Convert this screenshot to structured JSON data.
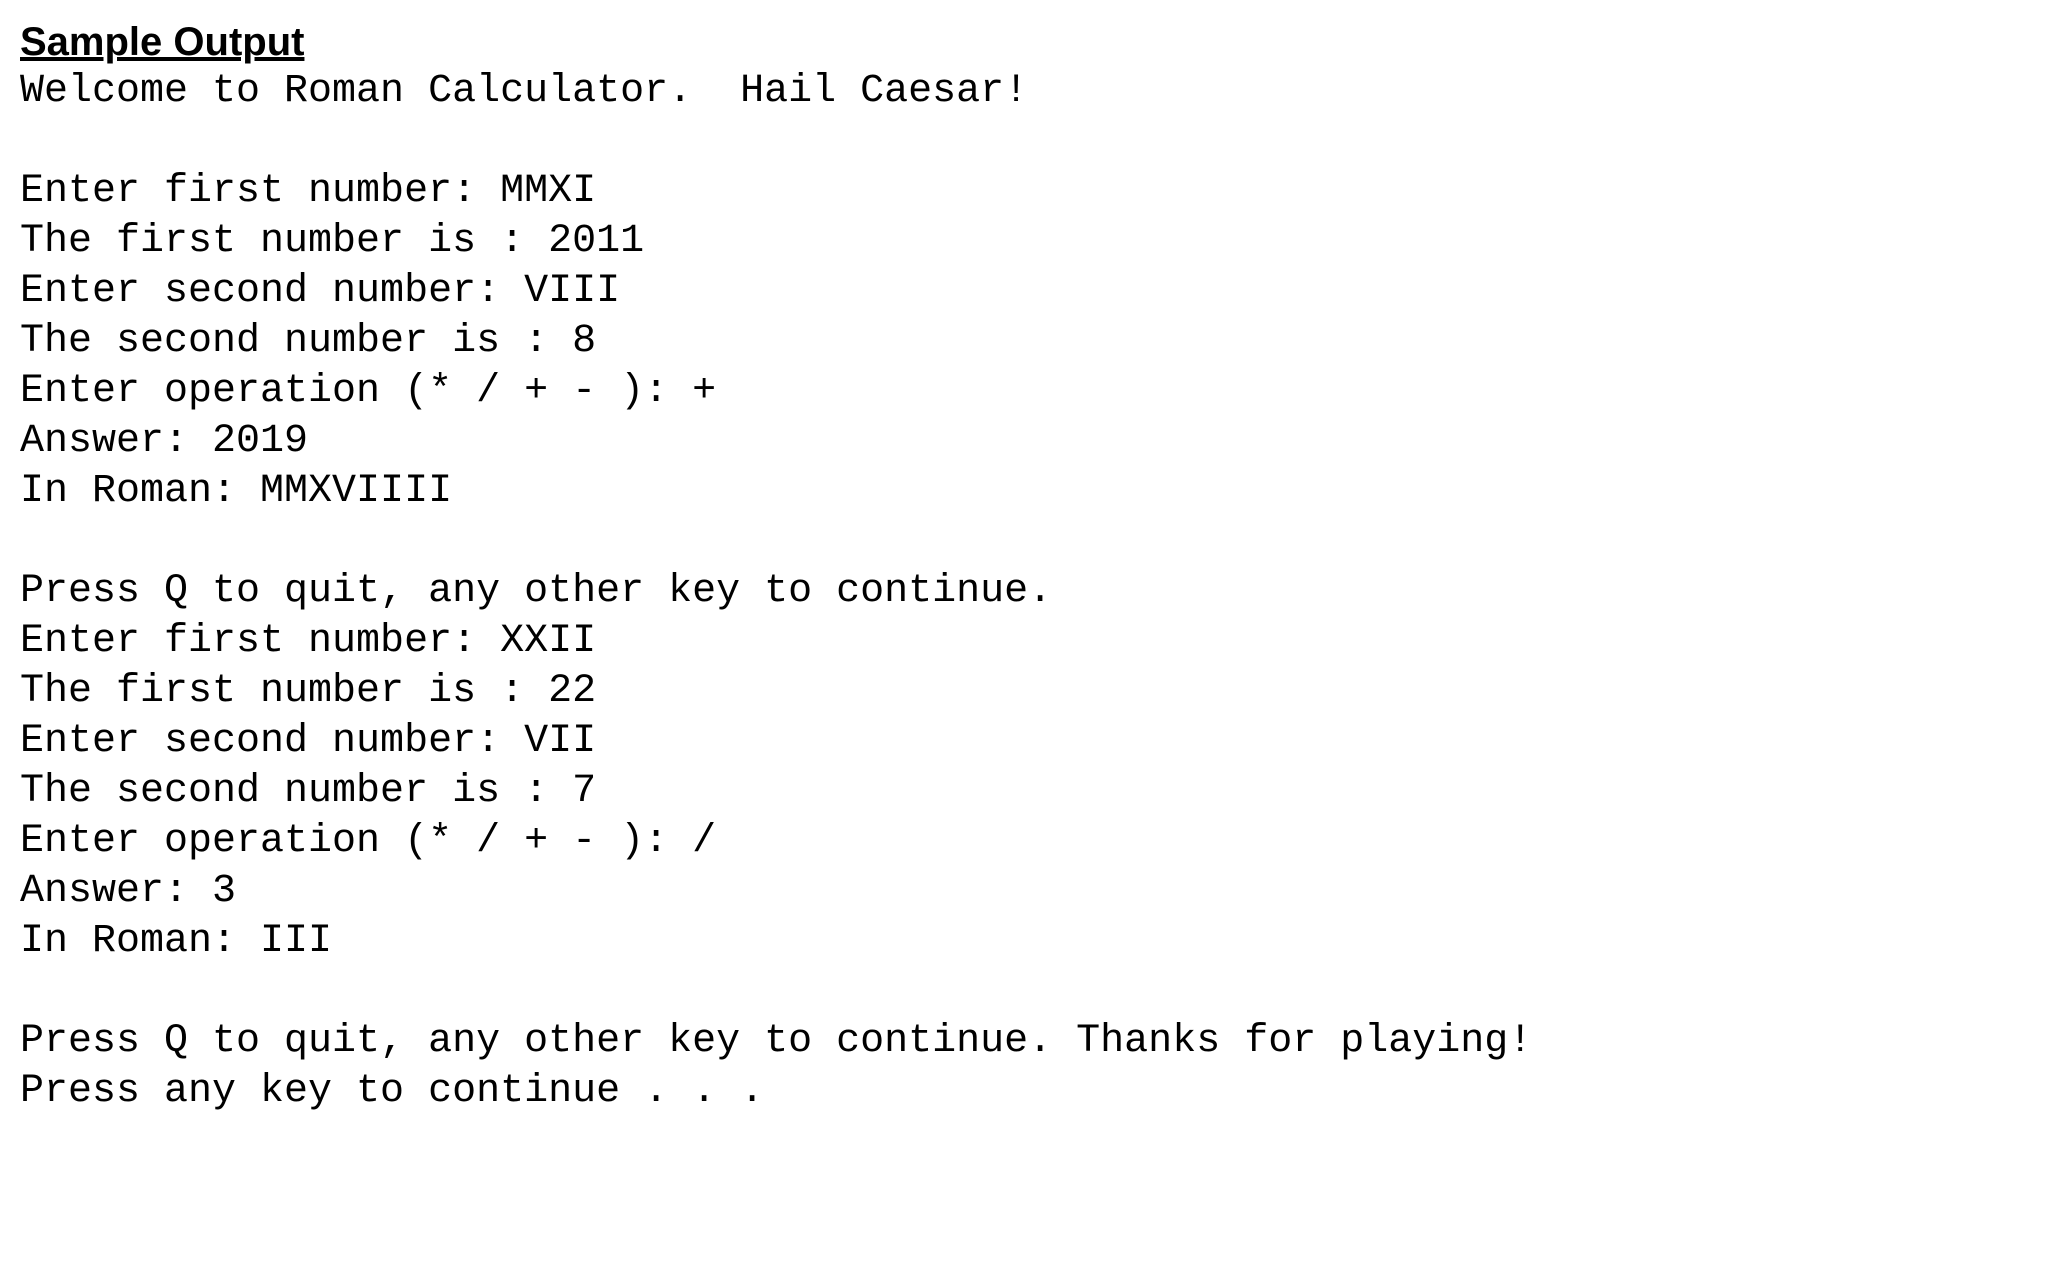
{
  "heading": "Sample Output",
  "lines": {
    "l0": "Welcome to Roman Calculator.  Hail Caesar!",
    "l1": "",
    "l2": "Enter first number: MMXI",
    "l3": "The first number is : 2011",
    "l4": "Enter second number: VIII",
    "l5": "The second number is : 8",
    "l6": "Enter operation (* / + - ): +",
    "l7": "Answer: 2019",
    "l8": "In Roman: MMXVIIII",
    "l9": "",
    "l10": "Press Q to quit, any other key to continue.",
    "l11": "Enter first number: XXII",
    "l12": "The first number is : 22",
    "l13": "Enter second number: VII",
    "l14": "The second number is : 7",
    "l15": "Enter operation (* / + - ): /",
    "l16": "Answer: 3",
    "l17": "In Roman: III",
    "l18": "",
    "l19": "Press Q to quit, any other key to continue. Thanks for playing!",
    "l20": "Press any key to continue . . ."
  }
}
